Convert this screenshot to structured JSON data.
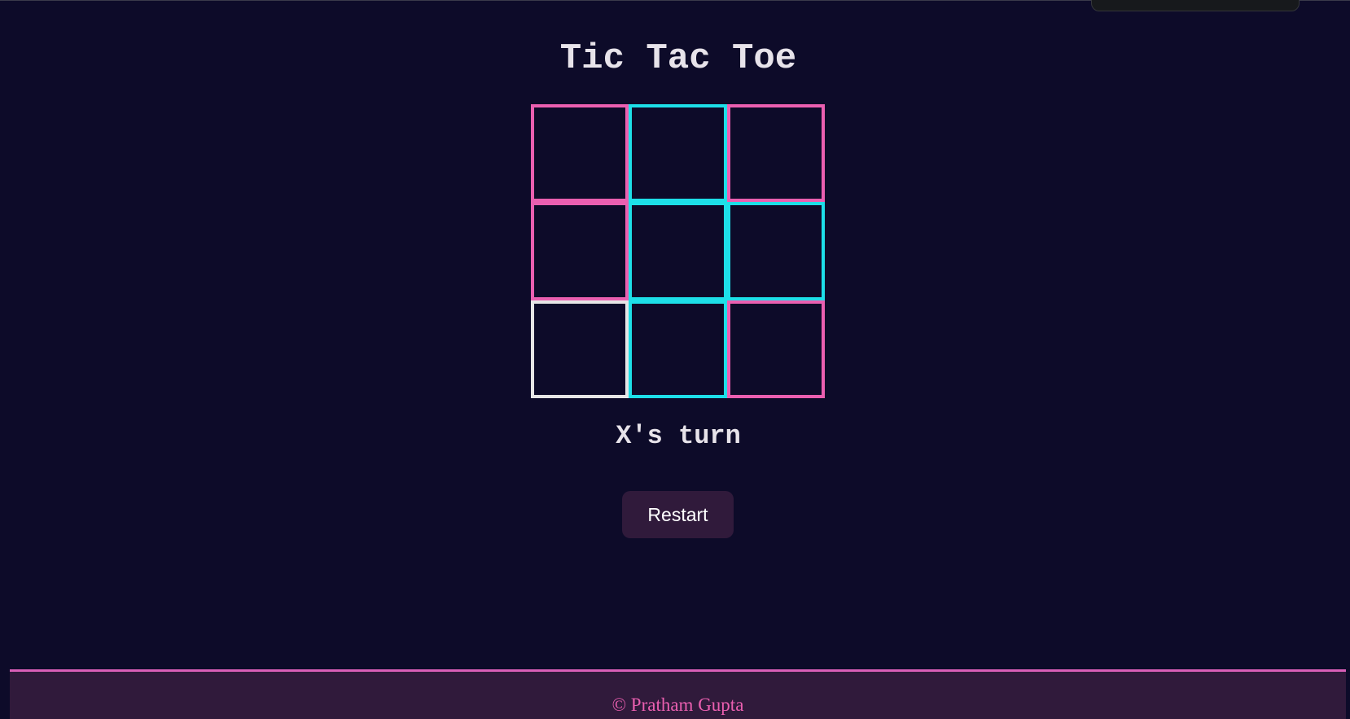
{
  "game": {
    "title": "Tic Tac Toe",
    "status": "X's turn",
    "restart_label": "Restart",
    "board": [
      {
        "mark": "",
        "border_color": "#ea5fb0"
      },
      {
        "mark": "",
        "border_color": "#1ddfe8"
      },
      {
        "mark": "",
        "border_color": "#ea5fb0"
      },
      {
        "mark": "",
        "border_color": "#ea5fb0"
      },
      {
        "mark": "",
        "border_color": "#1ddfe8"
      },
      {
        "mark": "",
        "border_color": "#1ddfe8"
      },
      {
        "mark": "",
        "border_color": "#e6e6e6"
      },
      {
        "mark": "",
        "border_color": "#1ddfe8"
      },
      {
        "mark": "",
        "border_color": "#ea5fb0"
      }
    ]
  },
  "footer": {
    "text": "© Pratham Gupta"
  },
  "colors": {
    "background": "#0d0b29",
    "accent_pink": "#ea5fb0",
    "accent_cyan": "#1ddfe8",
    "button_bg": "#301a3b",
    "text": "#e7e3ea"
  }
}
